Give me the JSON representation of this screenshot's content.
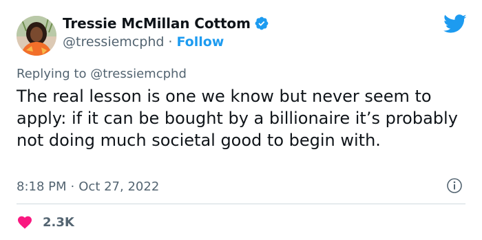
{
  "author": {
    "name": "Tressie McMillan Cottom",
    "handle": "@tressiemcphd",
    "separator": "·",
    "follow_label": "Follow"
  },
  "reply": {
    "prefix": "Replying to",
    "mention": "@tressiemcphd"
  },
  "tweet": {
    "text": "The real lesson is one we know but never seem to apply: if it can be bought by a billionaire it’s probably not doing much societal good to begin with.",
    "time": "8:18 PM",
    "separator": "·",
    "date": "Oct 27, 2022"
  },
  "engagement": {
    "likes": "2.3K"
  },
  "icons": {
    "brand": "twitter-bird-icon",
    "verified": "verified-badge-icon",
    "info": "info-icon",
    "like": "heart-icon"
  },
  "colors": {
    "accent": "#1d9bf0",
    "heart": "#f91880",
    "muted": "#536471",
    "text": "#0f1419"
  }
}
